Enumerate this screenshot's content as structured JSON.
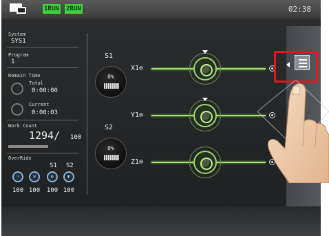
{
  "topbar": {
    "tag1": "1RUN",
    "tag2": "2RUN",
    "clock": "02:38",
    "icon": "pc-link-icon"
  },
  "info": {
    "system_label": "System",
    "system_value": "SYS1",
    "program_label": "Program",
    "program_value": "1",
    "remain_label": "Remain Time",
    "total_label": "Total",
    "total_value": "0:00:00",
    "current_label": "Current",
    "current_value": "0:00:03",
    "work_label": "Work Count",
    "work_value": "1294/",
    "work_target": "100",
    "override_label": "OverRide",
    "s1_label": "S1",
    "s2_label": "S2",
    "override_values": [
      "100",
      "100",
      "100",
      "100"
    ]
  },
  "spindles": [
    {
      "label": "S1",
      "percent": "0%"
    },
    {
      "label": "S2",
      "percent": "0%"
    }
  ],
  "axes": [
    {
      "label": "X1",
      "symbol": "⊖"
    },
    {
      "label": "Y1",
      "symbol": "⊖"
    },
    {
      "label": "Z1",
      "symbol": "⊖"
    }
  ],
  "menu": {
    "icon": "list-menu-icon",
    "highlight_color": "#e2161f"
  },
  "colors": {
    "accent_green": "#9fd86a",
    "status_green": "#3fcf3f"
  }
}
